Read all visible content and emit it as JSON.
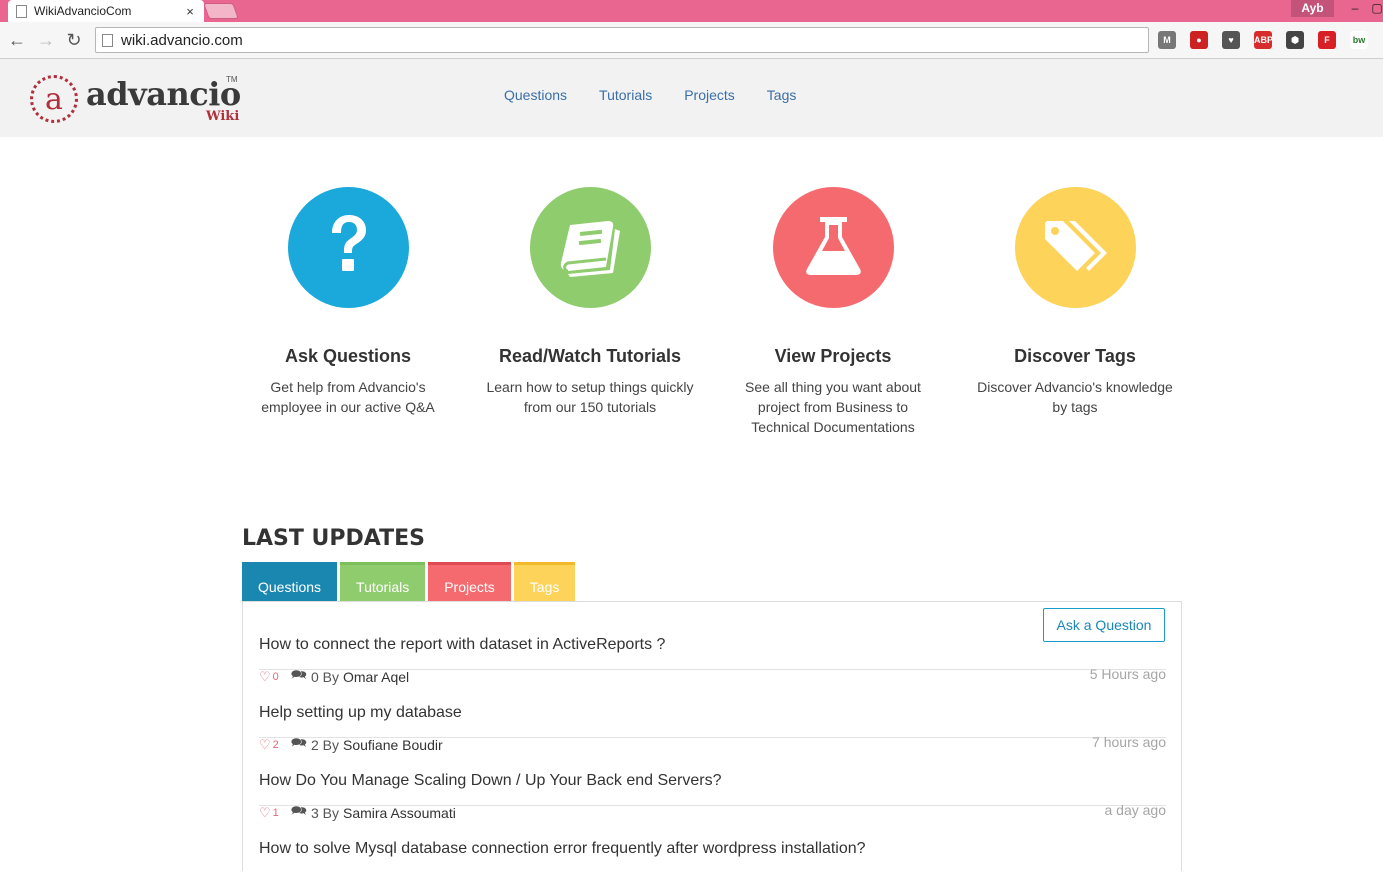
{
  "browser": {
    "tab_title": "WikiAdvancioCom",
    "tab_close": "×",
    "profile": "Ayb",
    "url": "wiki.advancio.com",
    "extensions": [
      {
        "name": "gmail-notifier-icon",
        "glyph": "M",
        "color": "#777777"
      },
      {
        "name": "stop-icon",
        "glyph": "●",
        "color": "#cc2222"
      },
      {
        "name": "pocket-icon",
        "glyph": "♥",
        "color": "#555555"
      },
      {
        "name": "adblock-icon",
        "glyph": "ABP",
        "color": "#d62c2c"
      },
      {
        "name": "settings-hex-icon",
        "glyph": "⬢",
        "color": "#444444"
      },
      {
        "name": "flipboard-icon",
        "glyph": "F",
        "color": "#d91f26"
      },
      {
        "name": "bw-icon",
        "glyph": "bw",
        "color": "#ffffff"
      }
    ]
  },
  "site": {
    "logo_letter": "a",
    "logo_name": "advancio",
    "logo_tm": "TM",
    "logo_sub": "Wiki",
    "nav": [
      "Questions",
      "Tutorials",
      "Projects",
      "Tags"
    ]
  },
  "features": [
    {
      "title": "Ask Questions",
      "line1": "Get help from Advancio's",
      "line2": "employee in our active Q&A",
      "line3": "",
      "color": "#1ba8db",
      "icon": "question-icon"
    },
    {
      "title": "Read/Watch Tutorials",
      "line1": "Learn how to setup things quickly",
      "line2": "from our 150 tutorials",
      "line3": "",
      "color": "#8fcc6e",
      "icon": "book-icon"
    },
    {
      "title": "View Projects",
      "line1": "See all thing you want about",
      "line2": "project from Business to",
      "line3": "Technical Documentations",
      "color": "#f56a6e",
      "icon": "flask-icon"
    },
    {
      "title": "Discover Tags",
      "line1": "Discover Advancio's knowledge",
      "line2": "by tags",
      "line3": "",
      "color": "#fdd35a",
      "icon": "tags-icon"
    }
  ],
  "updates": {
    "title": "LAST UPDATES",
    "tabs": [
      {
        "label": "Questions",
        "color": "#1a87b0",
        "top": "#1a87b0"
      },
      {
        "label": "Tutorials",
        "color": "#8fcc6e",
        "top": "#7dbf5a"
      },
      {
        "label": "Projects",
        "color": "#f56a6e",
        "top": "#e04a52"
      },
      {
        "label": "Tags",
        "color": "#fdd35a",
        "top": "#f2b92a"
      }
    ],
    "ask_button": "Ask a Question",
    "questions": [
      {
        "title": "How to connect the report with dataset in ActiveReports ?",
        "likes": "0",
        "comments": "0",
        "by": "By",
        "author": "Omar Aqel",
        "time": "5 Hours ago"
      },
      {
        "title": "Help setting up my database",
        "likes": "2",
        "comments": "2",
        "by": "By",
        "author": "Soufiane Boudir",
        "time": "7 hours ago"
      },
      {
        "title": "How Do You Manage Scaling Down / Up Your Back end Servers?",
        "likes": "1",
        "comments": "3",
        "by": "By",
        "author": "Samira Assoumati",
        "time": "a day ago"
      },
      {
        "title": "How to solve Mysql database connection error frequently after wordpress installation?",
        "likes": "",
        "comments": "",
        "by": "",
        "author": "",
        "time": ""
      }
    ]
  }
}
